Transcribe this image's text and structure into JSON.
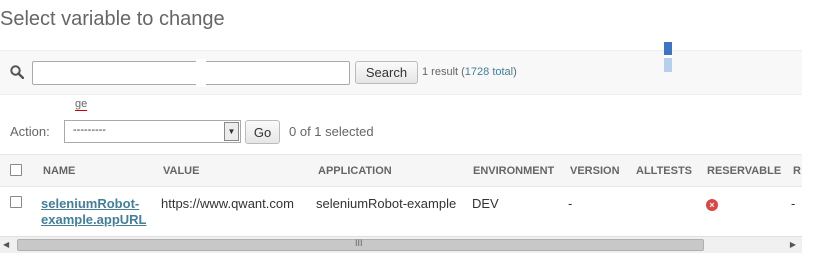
{
  "page": {
    "title": "Select variable to change"
  },
  "search": {
    "value": "",
    "button_label": "Search"
  },
  "results": {
    "prefix": "1 result (",
    "total_link": "1728 total",
    "suffix": ")"
  },
  "misc": {
    "fragment": "ge"
  },
  "actions": {
    "label": "Action:",
    "selected_option": "---------",
    "go_label": "Go",
    "selected_count": "0 of 1 selected"
  },
  "table": {
    "columns": [
      "NAME",
      "VALUE",
      "APPLICATION",
      "ENVIRONMENT",
      "VERSION",
      "ALLTESTS",
      "RESERVABLE",
      "R"
    ],
    "rows": [
      {
        "name_line1": "seleniumRobot-",
        "name_line2": "example.appURL",
        "value": "https://www.qwant.com",
        "application": "seleniumRobot-example",
        "environment": "DEV",
        "version": "-",
        "alltests": "",
        "reservable_icon": "red-x-circle-icon",
        "last": "-"
      }
    ]
  },
  "colors": {
    "link": "#447e9b",
    "error": "#dd4646",
    "marker": "#3d74c3"
  }
}
